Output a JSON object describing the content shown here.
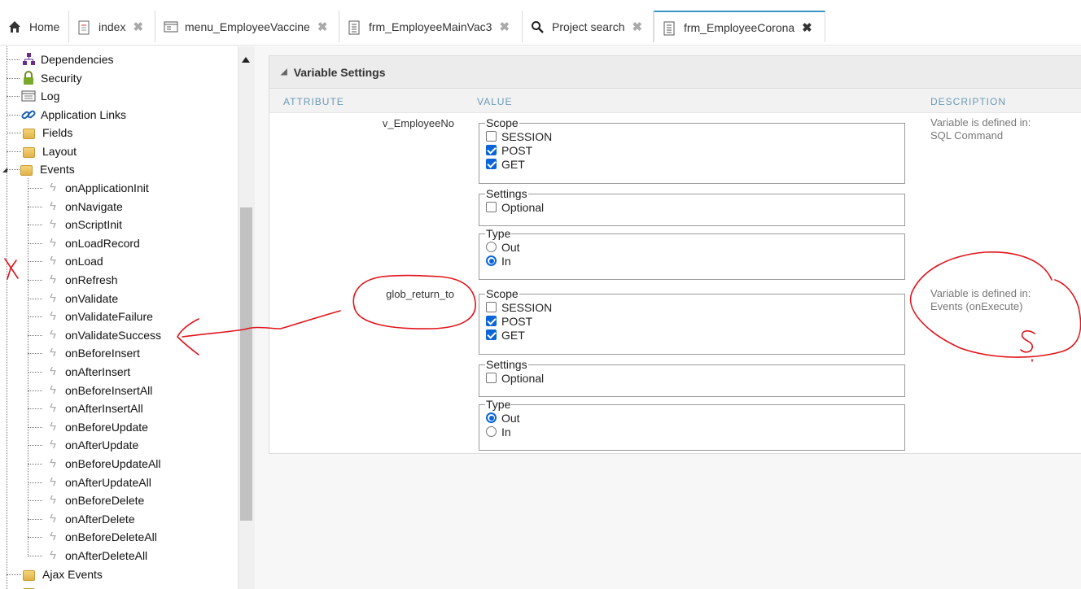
{
  "tabs": [
    {
      "label": "Home",
      "icon": "home-icon"
    },
    {
      "label": "index",
      "icon": "document-icon"
    },
    {
      "label": "menu_EmployeeVaccine",
      "icon": "menu-icon"
    },
    {
      "label": "frm_EmployeeMainVac3",
      "icon": "form-icon"
    },
    {
      "label": "Project search",
      "icon": "search-icon"
    },
    {
      "label": "frm_EmployeeCorona",
      "icon": "form-icon"
    }
  ],
  "tree": {
    "top_items": [
      "Dependencies",
      "Security",
      "Log",
      "Application Links",
      "Fields",
      "Layout",
      "Events"
    ],
    "events": [
      "onApplicationInit",
      "onNavigate",
      "onScriptInit",
      "onLoadRecord",
      "onLoad",
      "onRefresh",
      "onValidate",
      "onValidateFailure",
      "onValidateSuccess",
      "onBeforeInsert",
      "onAfterInsert",
      "onBeforeInsertAll",
      "onAfterInsertAll",
      "onBeforeUpdate",
      "onAfterUpdate",
      "onBeforeUpdateAll",
      "onAfterUpdateAll",
      "onBeforeDelete",
      "onAfterDelete",
      "onBeforeDeleteAll",
      "onAfterDeleteAll"
    ],
    "bottom_items": [
      "Ajax Events"
    ]
  },
  "panel": {
    "title": "Variable Settings",
    "columns": {
      "attribute": "ATTRIBUTE",
      "value": "VALUE",
      "description": "DESCRIPTION"
    },
    "variables": [
      {
        "name": "v_EmployeeNo",
        "scope_legend": "Scope",
        "scope": [
          {
            "label": "SESSION",
            "checked": false
          },
          {
            "label": "POST",
            "checked": true
          },
          {
            "label": "GET",
            "checked": true
          }
        ],
        "settings_legend": "Settings",
        "optional_label": "Optional",
        "optional": false,
        "type_legend": "Type",
        "type_out": "Out",
        "type_in": "In",
        "type_selected": "In",
        "desc_line1": "Variable is defined in:",
        "desc_line2": "SQL Command"
      },
      {
        "name": "glob_return_to",
        "scope_legend": "Scope",
        "scope": [
          {
            "label": "SESSION",
            "checked": false
          },
          {
            "label": "POST",
            "checked": true
          },
          {
            "label": "GET",
            "checked": true
          }
        ],
        "settings_legend": "Settings",
        "optional_label": "Optional",
        "optional": false,
        "type_legend": "Type",
        "type_out": "Out",
        "type_in": "In",
        "type_selected": "Out",
        "desc_line1": "Variable is defined in:",
        "desc_line2": "Events (onExecute)"
      }
    ]
  },
  "colors": {
    "accent": "#3a94c5",
    "check": "#0a66d8",
    "annotation": "#e0141b"
  }
}
